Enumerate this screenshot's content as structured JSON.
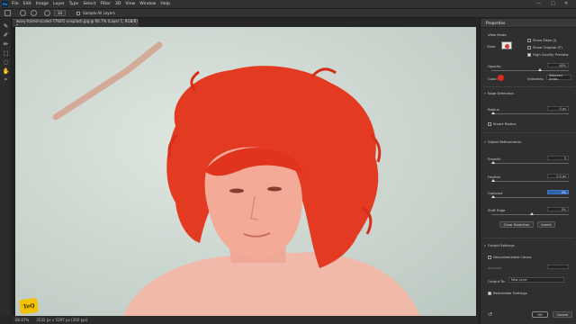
{
  "app": {
    "logo_text": "Ps"
  },
  "menu": [
    "File",
    "Edit",
    "Image",
    "Layer",
    "Type",
    "Select",
    "Filter",
    "3D",
    "View",
    "Window",
    "Help"
  ],
  "window_controls": {
    "minimize": "—",
    "maximize": "□",
    "close": "✕"
  },
  "options_bar": {
    "size_value": "30",
    "sample_all_layers": "Sample All Layers"
  },
  "document": {
    "tab_title": "wavy-haired-scaled-7792f1-unsplash.jpg @ 66.7% (Layer 1, RGB/8) *",
    "zoom": "66.67%",
    "doc_size": "3532 px x 5297 px (300 ppi)"
  },
  "properties": {
    "title": "Properties",
    "view_mode": {
      "header": "View Mode",
      "view_label": "View:",
      "show_edge": "Show Edge (J)",
      "show_original": "Show Original (P)",
      "high_quality_preview": "High Quality Preview"
    },
    "opacity": {
      "label": "Opacity",
      "value": "60%",
      "fraction": 0.6
    },
    "color": {
      "label": "Color:",
      "swatch": "#e0291d"
    },
    "indicates": {
      "label": "Indicates:",
      "value": "Selected Areas"
    },
    "edge_detection": {
      "header": "Edge Detection",
      "radius_label": "Radius",
      "radius_value": "0 px",
      "smart_radius": "Smart Radius"
    },
    "global_refinements": {
      "header": "Global Refinements",
      "smooth_label": "Smooth",
      "smooth_value": "0",
      "feather_label": "Feather",
      "feather_value": "0.0 px",
      "contrast_label": "Contrast",
      "contrast_value": "0%",
      "shift_edge_label": "Shift Edge",
      "shift_edge_value": "0%",
      "clear_selection": "Clear Selection",
      "invert": "Invert"
    },
    "output_settings": {
      "header": "Output Settings",
      "decontaminate": "Decontaminate Colors",
      "amount_label": "Amount",
      "output_to_label": "Output To:",
      "output_to_value": "New Layer",
      "remember": "Remember Settings"
    },
    "ok": "OK",
    "cancel": "Cancel"
  },
  "watermark": "TeQ"
}
